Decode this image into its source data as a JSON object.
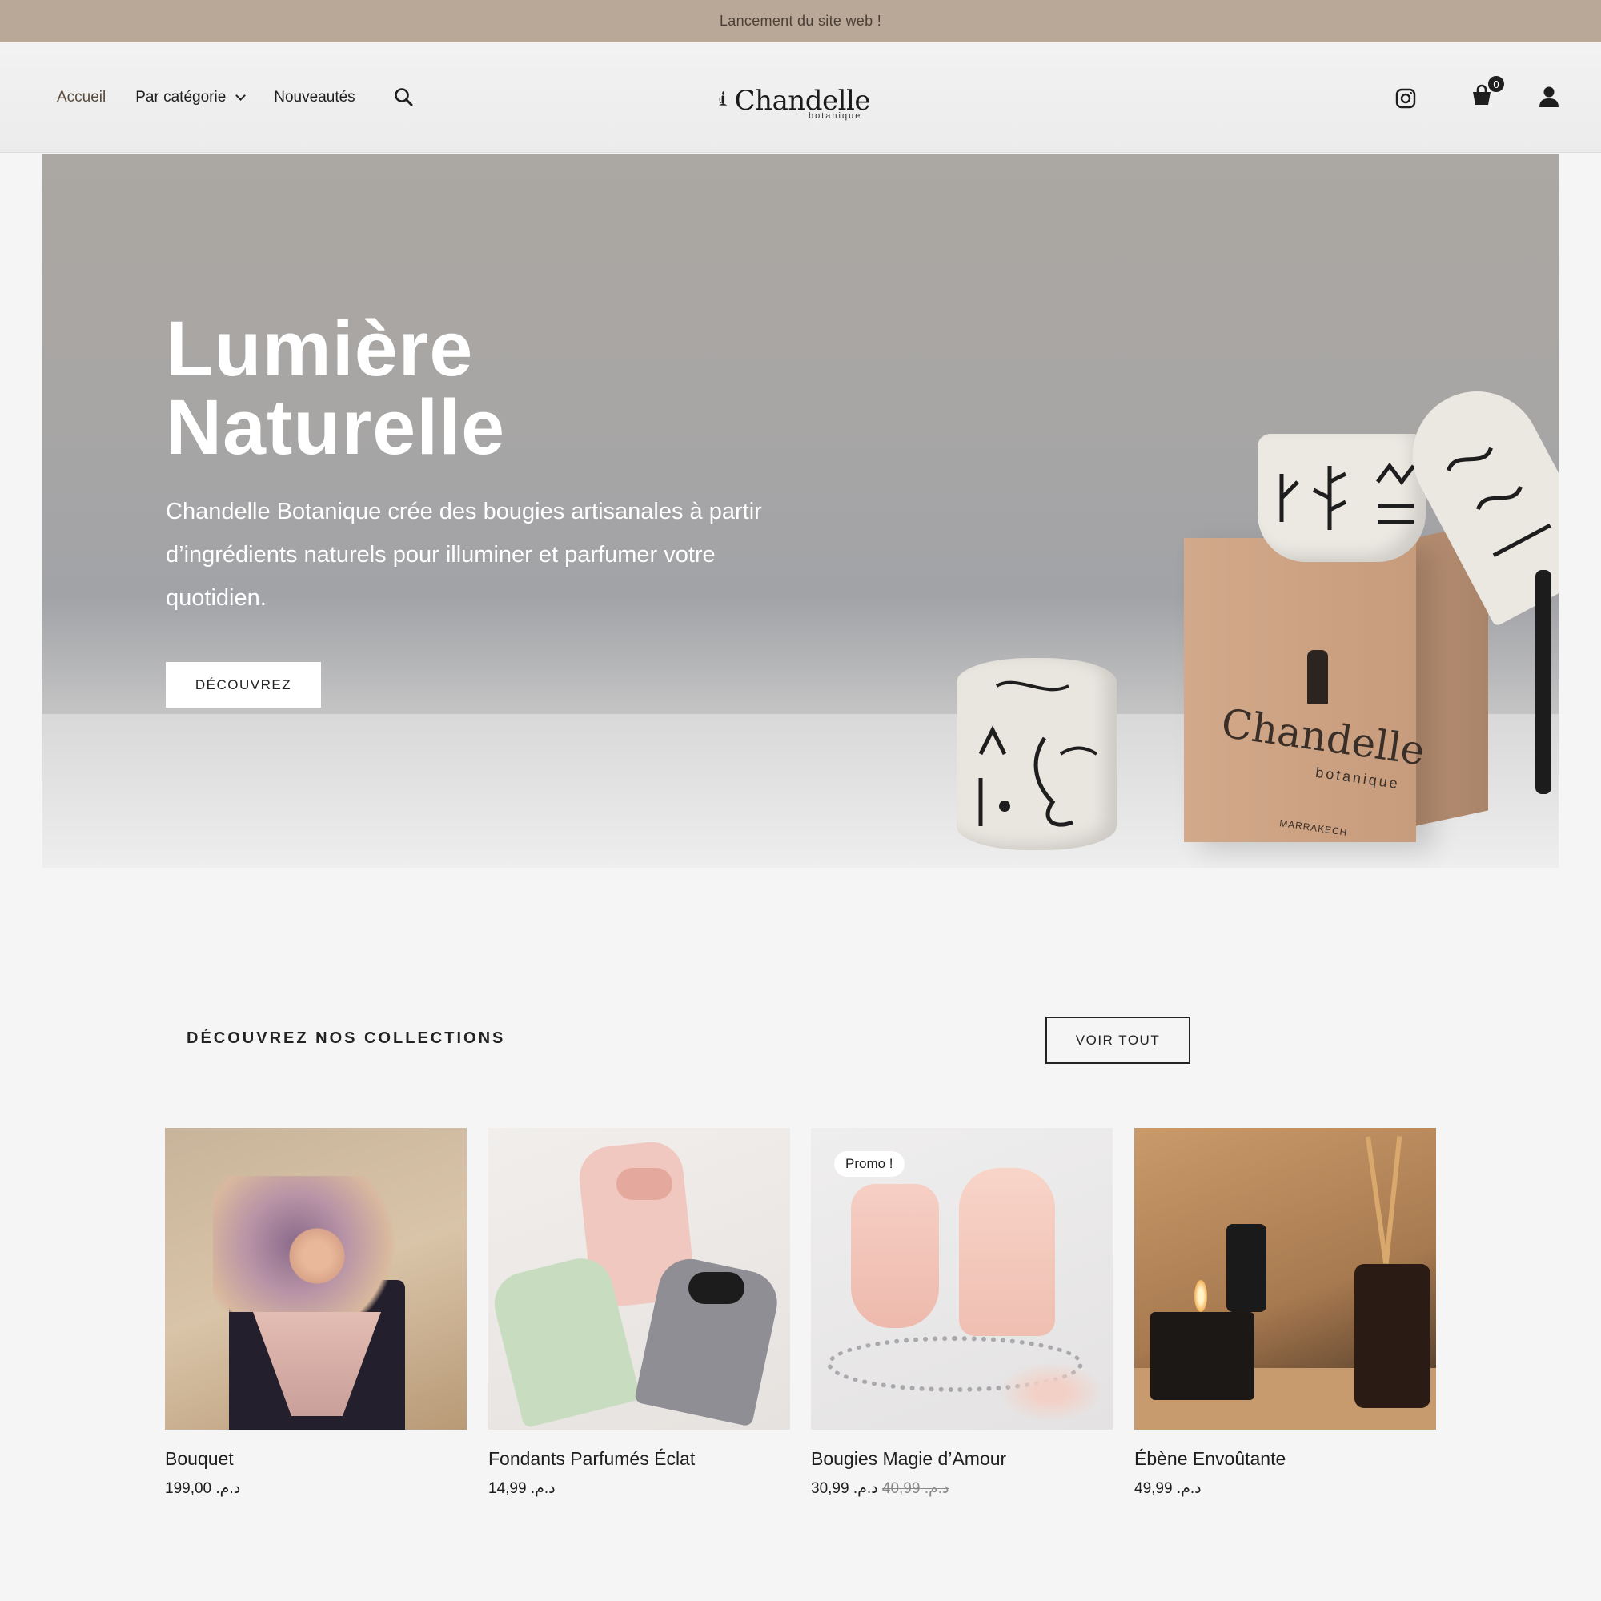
{
  "announcement": "Lancement du site web !",
  "header": {
    "nav": [
      {
        "label": "Accueil",
        "active": true
      },
      {
        "label": "Par catégorie"
      },
      {
        "label": "Nouveautés"
      }
    ],
    "logo": {
      "word": "Chandelle",
      "sub": "botanique"
    },
    "cart_count": "0",
    "icons": [
      "search-icon",
      "instagram-icon",
      "cart-icon",
      "user-icon"
    ]
  },
  "hero": {
    "title_line1": "Lumière",
    "title_line2": "Naturelle",
    "text": "Chandelle Botanique crée des bougies artisanales à partir d’ingrédients naturels pour illuminer et parfumer votre quotidien.",
    "button": "DÉCOUVREZ",
    "box_word": "Chandelle",
    "box_sub": "botanique",
    "box_city": "MARRAKECH"
  },
  "collections": {
    "title": "DÉCOUVREZ NOS COLLECTIONS",
    "button": "VOIR TOUT",
    "products": [
      {
        "name": "Bouquet",
        "price": "د.م. 199,00"
      },
      {
        "name": "Fondants Parfumés Éclat",
        "price": "د.م. 14,99"
      },
      {
        "name": "Bougies Magie d’Amour",
        "old_price": "د.م. 40,99",
        "price": "د.م. 30,99",
        "badge": "Promo !"
      },
      {
        "name": "Ébène Envoûtante",
        "price": "د.م. 49,99"
      }
    ]
  },
  "colors": {
    "announcement_bg": "#b9a898",
    "accent_text": "#5a4a3c",
    "dark": "#1e1e1e"
  }
}
